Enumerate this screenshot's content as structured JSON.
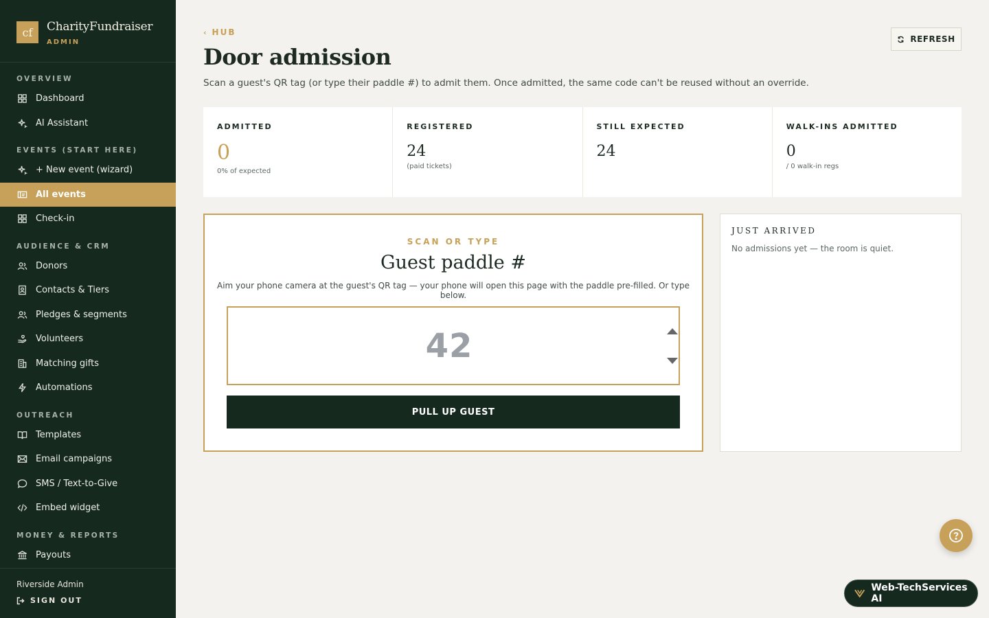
{
  "brand": {
    "logo": "cf",
    "name": "CharityFundraiser",
    "sub": "ADMIN"
  },
  "sidebar": {
    "sections": [
      {
        "title": "OVERVIEW",
        "items": [
          {
            "label": "Dashboard",
            "icon": "grid-icon"
          },
          {
            "label": "AI Assistant",
            "icon": "sparkle-icon"
          }
        ]
      },
      {
        "title": "EVENTS (START HERE)",
        "items": [
          {
            "label": "+ New event (wizard)",
            "icon": "sparkle-icon"
          },
          {
            "label": "All events",
            "icon": "ticket-icon",
            "active": true
          },
          {
            "label": "Check-in",
            "icon": "grid-icon"
          }
        ]
      },
      {
        "title": "AUDIENCE & CRM",
        "items": [
          {
            "label": "Donors",
            "icon": "users-icon"
          },
          {
            "label": "Contacts & Tiers",
            "icon": "contact-card-icon"
          },
          {
            "label": "Pledges & segments",
            "icon": "users-icon"
          },
          {
            "label": "Volunteers",
            "icon": "hand-heart-icon"
          },
          {
            "label": "Matching gifts",
            "icon": "building-icon"
          },
          {
            "label": "Automations",
            "icon": "bolt-icon"
          }
        ]
      },
      {
        "title": "OUTREACH",
        "items": [
          {
            "label": "Templates",
            "icon": "book-icon"
          },
          {
            "label": "Email campaigns",
            "icon": "mail-icon"
          },
          {
            "label": "SMS / Text-to-Give",
            "icon": "chat-bubble-icon"
          },
          {
            "label": "Embed widget",
            "icon": "code-icon"
          }
        ]
      },
      {
        "title": "MONEY & REPORTS",
        "items": [
          {
            "label": "Payouts",
            "icon": "bank-icon"
          }
        ]
      }
    ],
    "footer": {
      "user": "Riverside Admin",
      "signout": "SIGN OUT"
    }
  },
  "header": {
    "back": "HUB",
    "title": "Door admission",
    "description": "Scan a guest's QR tag (or type their paddle #) to admit them. Once admitted, the same code can't be reused without an override.",
    "refresh": "REFRESH"
  },
  "stats": [
    {
      "label": "ADMITTED",
      "value": "0",
      "note": "0% of expected"
    },
    {
      "label": "REGISTERED",
      "value": "24",
      "note": "(paid tickets)"
    },
    {
      "label": "STILL EXPECTED",
      "value": "24",
      "note": ""
    },
    {
      "label": "WALK-INS ADMITTED",
      "value": "0",
      "note": "/ 0 walk-in regs"
    }
  ],
  "scan": {
    "eyebrow": "SCAN OR TYPE",
    "title": "Guest paddle #",
    "help": "Aim your phone camera at the guest's QR tag — your phone will open this page with the paddle pre-filled. Or type below.",
    "placeholder": "42",
    "button": "PULL UP GUEST"
  },
  "arrived": {
    "title": "JUST ARRIVED",
    "empty": "No admissions yet — the room is quiet."
  },
  "badge": {
    "label": "Web-TechServices AI"
  },
  "colors": {
    "sidebar_bg": "#16291f",
    "accent_gold": "#c7a15a",
    "page_bg": "#f4f2ee"
  }
}
